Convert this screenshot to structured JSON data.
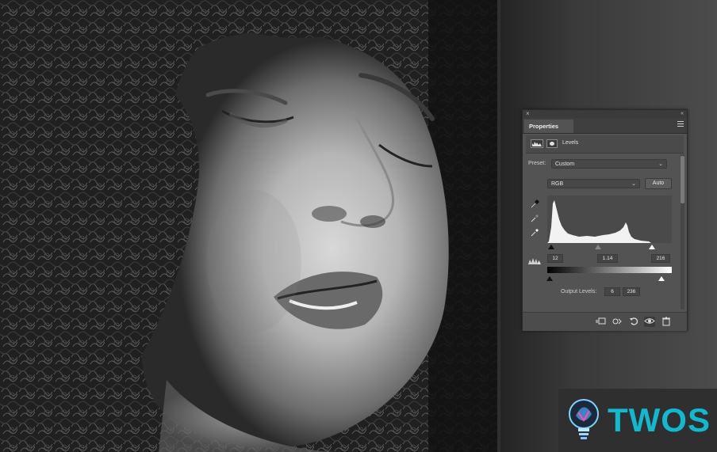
{
  "panel": {
    "close_glyph": "×",
    "collapse_glyph": "«",
    "tab_label": "Properties",
    "header_label": "Levels",
    "preset_label": "Preset:",
    "preset_value": "Custom",
    "channel_value": "RGB",
    "auto_label": "Auto",
    "input_black": "12",
    "input_gamma": "1.14",
    "input_white": "216",
    "output_label": "Output Levels:",
    "output_black": "6",
    "output_white": "236"
  },
  "icons": {
    "eyedroppers": [
      "black-point-eyedropper-icon",
      "gray-point-eyedropper-icon",
      "white-point-eyedropper-icon"
    ],
    "bottom": [
      "clip-to-layer-icon",
      "view-previous-icon",
      "reset-icon",
      "visibility-eye-icon",
      "delete-icon"
    ]
  },
  "colors": {
    "accent": "#12b8cf",
    "panel_bg": "#535353"
  },
  "logo": {
    "text": "TWOS"
  }
}
